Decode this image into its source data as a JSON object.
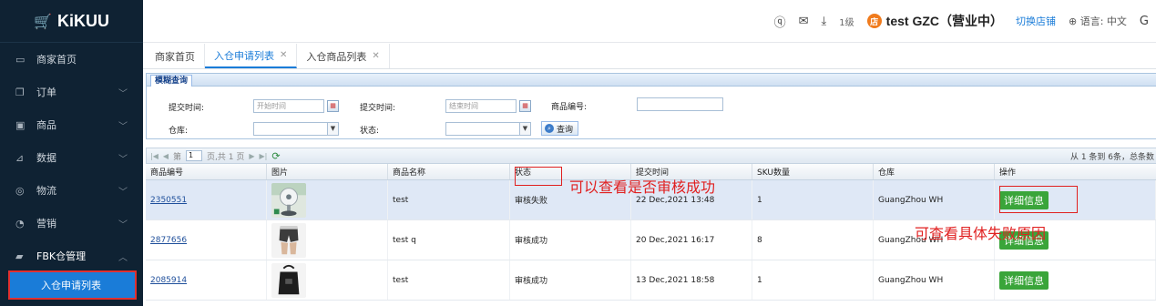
{
  "app": {
    "logo": "KiKUU",
    "logo_icon": "cart-icon"
  },
  "sidebar": {
    "items": [
      {
        "icon": "▭",
        "label": "商家首页",
        "chevron": false
      },
      {
        "icon": "❐",
        "label": "订单",
        "chevron": true
      },
      {
        "icon": "▣",
        "label": "商品",
        "chevron": true
      },
      {
        "icon": "⊿",
        "label": "数据",
        "chevron": true
      },
      {
        "icon": "◎",
        "label": "物流",
        "chevron": true
      },
      {
        "icon": "◔",
        "label": "营销",
        "chevron": true
      },
      {
        "icon": "▰",
        "label": "FBK仓管理",
        "chevron": true,
        "open": true
      }
    ],
    "active_sub": "入仓申请列表"
  },
  "topbar": {
    "level": "1级",
    "shop_name": "test GZC（营业中）",
    "switch_shop": "切换店铺",
    "language": "语言: 中文",
    "logout_glyph": "G"
  },
  "tabs": [
    {
      "label": "商家首页",
      "closable": false,
      "active": false
    },
    {
      "label": "入仓申请列表",
      "closable": true,
      "active": true
    },
    {
      "label": "入仓商品列表",
      "closable": true,
      "active": false
    }
  ],
  "filter": {
    "title": "模糊查询",
    "submit_time_label": "提交时间:",
    "start_placeholder": "开始时间",
    "end_placeholder": "结束时间",
    "product_code_label": "商品编号:",
    "warehouse_label": "仓库:",
    "status_label": "状态:",
    "query_button": "查询"
  },
  "pager": {
    "page_prefix": "第",
    "page_value": "1",
    "page_suffix": "页,共 1 页",
    "info": "从 1 条到 6条，总条数"
  },
  "grid": {
    "columns": [
      "商品编号",
      "图片",
      "商品名称",
      "状态",
      "提交时间",
      "SKU数量",
      "仓库",
      "操作"
    ],
    "detail_label": "详细信息",
    "rows": [
      {
        "code": "2350551",
        "image": "fan",
        "name": "test",
        "status": "审核失败",
        "time": "22 Dec,2021 13:48",
        "sku": "1",
        "warehouse": "GuangZhou WH"
      },
      {
        "code": "2877656",
        "image": "shorts",
        "name": "test q",
        "status": "审核成功",
        "time": "20 Dec,2021 16:17",
        "sku": "8",
        "warehouse": "GuangZhou WH"
      },
      {
        "code": "2085914",
        "image": "bag",
        "name": "test",
        "status": "审核成功",
        "time": "13 Dec,2021 18:58",
        "sku": "1",
        "warehouse": "GuangZhou WH"
      }
    ]
  },
  "annotations": {
    "status_note": "可以查看是否审核成功",
    "reason_note": "可查看具体失败原因",
    "color": "#e02020"
  }
}
